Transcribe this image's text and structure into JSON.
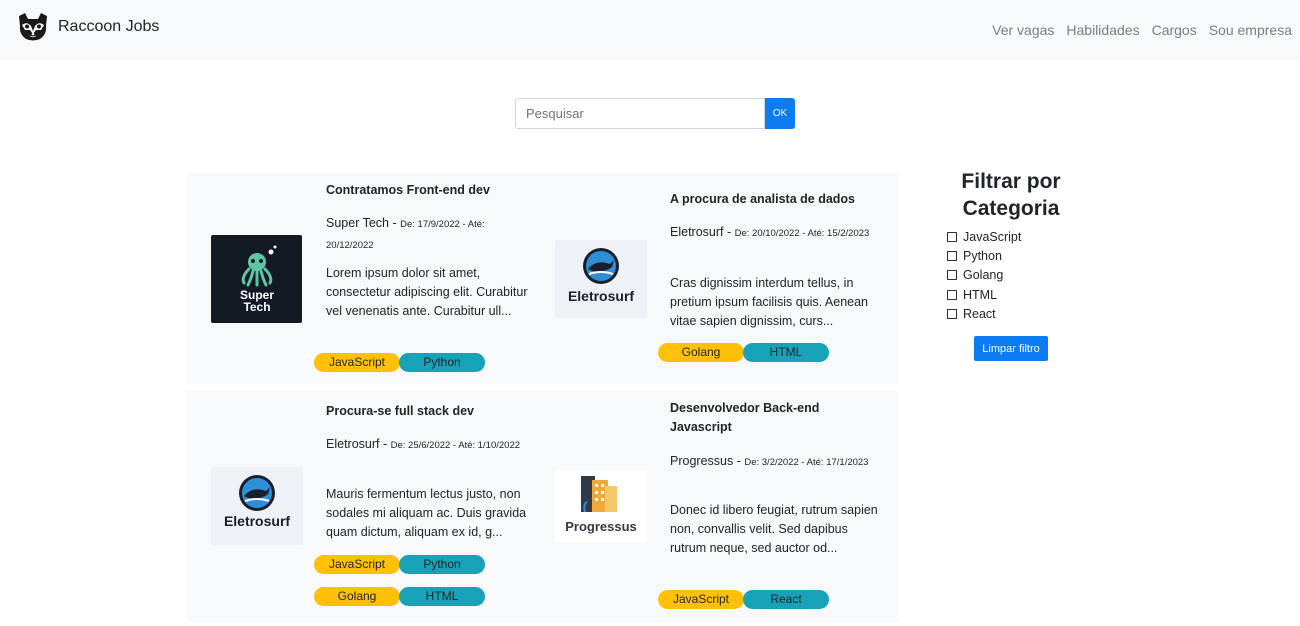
{
  "navbar": {
    "brand": "Raccoon Jobs",
    "links": [
      "Ver vagas",
      "Habilidades",
      "Cargos",
      "Sou empresa"
    ]
  },
  "search": {
    "placeholder": "Pesquisar",
    "button": "OK"
  },
  "jobs": [
    {
      "title": "Contratamos Front-end dev",
      "company": "Super Tech",
      "dates": "De: 17/9/2022 - Até: 20/12/2022",
      "description": "Lorem ipsum dolor sit amet, consectetur adipiscing elit. Curabitur vel venenatis ante. Curabitur ull...",
      "tags": [
        "JavaScript",
        "Python"
      ],
      "logo_text": [
        "Super",
        "Tech"
      ]
    },
    {
      "title": "A procura de analista de dados",
      "company": "Eletrosurf",
      "dates": "De: 20/10/2022 - Até: 15/2/2023",
      "description": "Cras dignissim interdum tellus, in pretium ipsum facilisis quis. Aenean vitae sapien dignissim, curs...",
      "tags": [
        "Golang",
        "HTML"
      ],
      "logo_text": "Eletrosurf"
    },
    {
      "title": "Procura-se full stack dev",
      "company": "Eletrosurf",
      "dates": "De: 25/6/2022 - Até: 1/10/2022",
      "description": "Mauris fermentum lectus justo, non sodales mi aliquam ac. Duis gravida quam dictum, aliquam ex id, g...",
      "tags": [
        "JavaScript",
        "Python",
        "Golang",
        "HTML"
      ],
      "logo_text": "Eletrosurf"
    },
    {
      "title": "Desenvolvedor Back-end Javascript",
      "company": "Progressus",
      "dates": "De: 3/2/2022 - Até: 17/1/2023",
      "description": "Donec id libero feugiat, rutrum sapien non, convallis velit. Sed dapibus rutrum neque, sed auctor od...",
      "tags": [
        "JavaScript",
        "React"
      ],
      "logo_text": "Progressus"
    }
  ],
  "filter": {
    "title": "Filtrar por Categoria",
    "categories": [
      "JavaScript",
      "Python",
      "Golang",
      "HTML",
      "React"
    ],
    "clear_button": "Limpar filtro"
  },
  "colors": {
    "primary": "#0d7cf2",
    "tag_yellow": "#ffc107",
    "tag_teal": "#17a2b8",
    "navbar_bg": "#f8f9fa"
  }
}
